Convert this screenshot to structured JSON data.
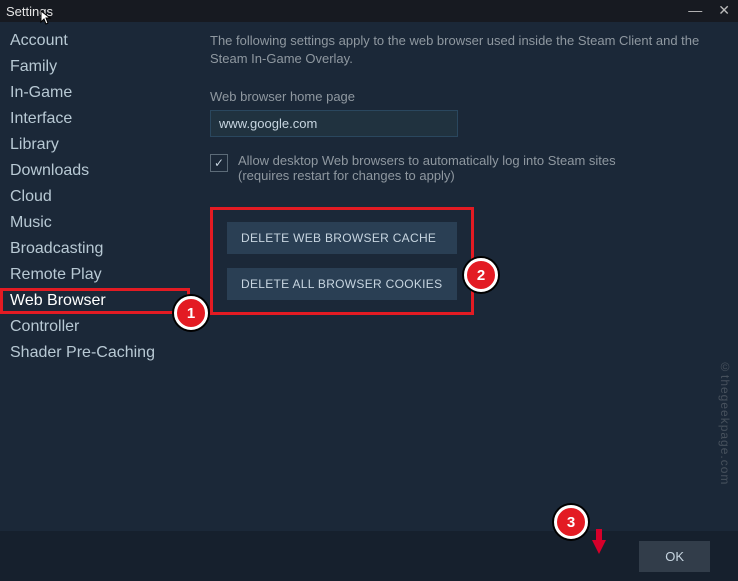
{
  "window": {
    "title": "Settings",
    "close": "✕",
    "minimize": "—"
  },
  "sidebar": {
    "items": [
      {
        "label": "Account"
      },
      {
        "label": "Family"
      },
      {
        "label": "In-Game"
      },
      {
        "label": "Interface"
      },
      {
        "label": "Library"
      },
      {
        "label": "Downloads"
      },
      {
        "label": "Cloud"
      },
      {
        "label": "Music"
      },
      {
        "label": "Broadcasting"
      },
      {
        "label": "Remote Play"
      },
      {
        "label": "Web Browser",
        "selected": true
      },
      {
        "label": "Controller"
      },
      {
        "label": "Shader Pre-Caching"
      }
    ]
  },
  "pane": {
    "description": "The following settings apply to the web browser used inside the Steam Client and the Steam In-Game Overlay.",
    "homepage_label": "Web browser home page",
    "homepage_value": "www.google.com",
    "auto_login_label": "Allow desktop Web browsers to automatically log into Steam sites",
    "auto_login_sub": "(requires restart for changes to apply)",
    "auto_login_checked": "✓",
    "btn_delete_cache": "DELETE WEB BROWSER CACHE",
    "btn_delete_cookies": "DELETE ALL BROWSER COOKIES"
  },
  "footer": {
    "ok": "OK"
  },
  "badges": {
    "one": "1",
    "two": "2",
    "three": "3"
  },
  "watermark": "©thegeekpage.com"
}
